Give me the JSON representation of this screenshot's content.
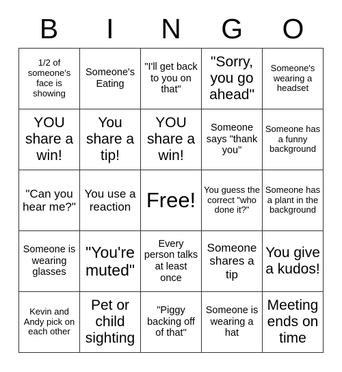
{
  "card": {
    "title": "BINGO",
    "header_letters": [
      "B",
      "I",
      "N",
      "G",
      "O"
    ],
    "colors": {
      "background": "#ffffff",
      "text": "#000000",
      "grid_line": "#333333"
    },
    "grid": {
      "rows": 5,
      "columns": 5
    }
  },
  "cells": [
    {
      "id": "b1",
      "text": "1/2 of someone's face is showing",
      "size": "size-xs"
    },
    {
      "id": "i1",
      "text": "Someone's Eating",
      "size": "size-sm"
    },
    {
      "id": "n1",
      "text": "\"I'll get back to you on that\"",
      "size": "size-sm"
    },
    {
      "id": "g1",
      "text": "\"Sorry, you go ahead\"",
      "size": "size-lg"
    },
    {
      "id": "o1",
      "text": "Someone's wearing a headset",
      "size": "size-xs"
    },
    {
      "id": "b2",
      "text": "YOU share a win!",
      "size": "size-lg"
    },
    {
      "id": "i2",
      "text": "You share a tip!",
      "size": "size-lg"
    },
    {
      "id": "n2",
      "text": "YOU share a win!",
      "size": "size-lg"
    },
    {
      "id": "g2",
      "text": "Someone says \"thank you\"",
      "size": "size-sm"
    },
    {
      "id": "o2",
      "text": "Someone has a funny background",
      "size": "size-xs"
    },
    {
      "id": "b3",
      "text": "\"Can you hear me?\"",
      "size": "size-md"
    },
    {
      "id": "i3",
      "text": "You use a reaction",
      "size": "size-md"
    },
    {
      "id": "n3",
      "text": "Free!",
      "size": "size-xxl"
    },
    {
      "id": "g3",
      "text": "You guess the correct \"who done it?\"",
      "size": "size-xs"
    },
    {
      "id": "o3",
      "text": "Someone has a plant in the background",
      "size": "size-xs"
    },
    {
      "id": "b4",
      "text": "Someone is wearing glasses",
      "size": "size-sm"
    },
    {
      "id": "i4",
      "text": "\"You're muted\"",
      "size": "size-xl"
    },
    {
      "id": "n4",
      "text": "Every person talks at least once",
      "size": "size-sm"
    },
    {
      "id": "g4",
      "text": "Someone shares a tip",
      "size": "size-md"
    },
    {
      "id": "o4",
      "text": "You give a kudos!",
      "size": "size-lg"
    },
    {
      "id": "b5",
      "text": "Kevin and Andy pick on each other",
      "size": "size-xs"
    },
    {
      "id": "i5",
      "text": "Pet or child sighting",
      "size": "size-lg"
    },
    {
      "id": "n5",
      "text": "\"Piggy backing off of that\"",
      "size": "size-sm"
    },
    {
      "id": "g5",
      "text": "Someone is wearing a hat",
      "size": "size-sm"
    },
    {
      "id": "o5",
      "text": "Meeting ends on time",
      "size": "size-lg"
    }
  ]
}
